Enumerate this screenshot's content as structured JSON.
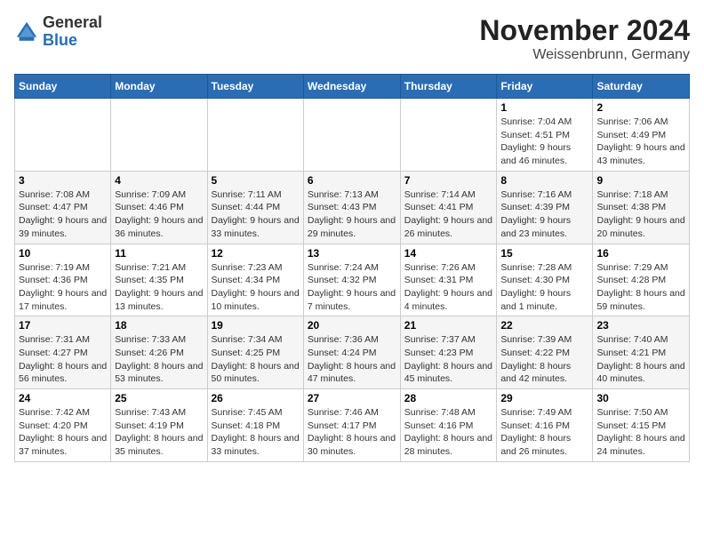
{
  "logo": {
    "general": "General",
    "blue": "Blue"
  },
  "title": "November 2024",
  "subtitle": "Weissenbrunn, Germany",
  "headers": [
    "Sunday",
    "Monday",
    "Tuesday",
    "Wednesday",
    "Thursday",
    "Friday",
    "Saturday"
  ],
  "weeks": [
    [
      {
        "day": "",
        "info": ""
      },
      {
        "day": "",
        "info": ""
      },
      {
        "day": "",
        "info": ""
      },
      {
        "day": "",
        "info": ""
      },
      {
        "day": "",
        "info": ""
      },
      {
        "day": "1",
        "info": "Sunrise: 7:04 AM\nSunset: 4:51 PM\nDaylight: 9 hours and 46 minutes."
      },
      {
        "day": "2",
        "info": "Sunrise: 7:06 AM\nSunset: 4:49 PM\nDaylight: 9 hours and 43 minutes."
      }
    ],
    [
      {
        "day": "3",
        "info": "Sunrise: 7:08 AM\nSunset: 4:47 PM\nDaylight: 9 hours and 39 minutes."
      },
      {
        "day": "4",
        "info": "Sunrise: 7:09 AM\nSunset: 4:46 PM\nDaylight: 9 hours and 36 minutes."
      },
      {
        "day": "5",
        "info": "Sunrise: 7:11 AM\nSunset: 4:44 PM\nDaylight: 9 hours and 33 minutes."
      },
      {
        "day": "6",
        "info": "Sunrise: 7:13 AM\nSunset: 4:43 PM\nDaylight: 9 hours and 29 minutes."
      },
      {
        "day": "7",
        "info": "Sunrise: 7:14 AM\nSunset: 4:41 PM\nDaylight: 9 hours and 26 minutes."
      },
      {
        "day": "8",
        "info": "Sunrise: 7:16 AM\nSunset: 4:39 PM\nDaylight: 9 hours and 23 minutes."
      },
      {
        "day": "9",
        "info": "Sunrise: 7:18 AM\nSunset: 4:38 PM\nDaylight: 9 hours and 20 minutes."
      }
    ],
    [
      {
        "day": "10",
        "info": "Sunrise: 7:19 AM\nSunset: 4:36 PM\nDaylight: 9 hours and 17 minutes."
      },
      {
        "day": "11",
        "info": "Sunrise: 7:21 AM\nSunset: 4:35 PM\nDaylight: 9 hours and 13 minutes."
      },
      {
        "day": "12",
        "info": "Sunrise: 7:23 AM\nSunset: 4:34 PM\nDaylight: 9 hours and 10 minutes."
      },
      {
        "day": "13",
        "info": "Sunrise: 7:24 AM\nSunset: 4:32 PM\nDaylight: 9 hours and 7 minutes."
      },
      {
        "day": "14",
        "info": "Sunrise: 7:26 AM\nSunset: 4:31 PM\nDaylight: 9 hours and 4 minutes."
      },
      {
        "day": "15",
        "info": "Sunrise: 7:28 AM\nSunset: 4:30 PM\nDaylight: 9 hours and 1 minute."
      },
      {
        "day": "16",
        "info": "Sunrise: 7:29 AM\nSunset: 4:28 PM\nDaylight: 8 hours and 59 minutes."
      }
    ],
    [
      {
        "day": "17",
        "info": "Sunrise: 7:31 AM\nSunset: 4:27 PM\nDaylight: 8 hours and 56 minutes."
      },
      {
        "day": "18",
        "info": "Sunrise: 7:33 AM\nSunset: 4:26 PM\nDaylight: 8 hours and 53 minutes."
      },
      {
        "day": "19",
        "info": "Sunrise: 7:34 AM\nSunset: 4:25 PM\nDaylight: 8 hours and 50 minutes."
      },
      {
        "day": "20",
        "info": "Sunrise: 7:36 AM\nSunset: 4:24 PM\nDaylight: 8 hours and 47 minutes."
      },
      {
        "day": "21",
        "info": "Sunrise: 7:37 AM\nSunset: 4:23 PM\nDaylight: 8 hours and 45 minutes."
      },
      {
        "day": "22",
        "info": "Sunrise: 7:39 AM\nSunset: 4:22 PM\nDaylight: 8 hours and 42 minutes."
      },
      {
        "day": "23",
        "info": "Sunrise: 7:40 AM\nSunset: 4:21 PM\nDaylight: 8 hours and 40 minutes."
      }
    ],
    [
      {
        "day": "24",
        "info": "Sunrise: 7:42 AM\nSunset: 4:20 PM\nDaylight: 8 hours and 37 minutes."
      },
      {
        "day": "25",
        "info": "Sunrise: 7:43 AM\nSunset: 4:19 PM\nDaylight: 8 hours and 35 minutes."
      },
      {
        "day": "26",
        "info": "Sunrise: 7:45 AM\nSunset: 4:18 PM\nDaylight: 8 hours and 33 minutes."
      },
      {
        "day": "27",
        "info": "Sunrise: 7:46 AM\nSunset: 4:17 PM\nDaylight: 8 hours and 30 minutes."
      },
      {
        "day": "28",
        "info": "Sunrise: 7:48 AM\nSunset: 4:16 PM\nDaylight: 8 hours and 28 minutes."
      },
      {
        "day": "29",
        "info": "Sunrise: 7:49 AM\nSunset: 4:16 PM\nDaylight: 8 hours and 26 minutes."
      },
      {
        "day": "30",
        "info": "Sunrise: 7:50 AM\nSunset: 4:15 PM\nDaylight: 8 hours and 24 minutes."
      }
    ]
  ]
}
